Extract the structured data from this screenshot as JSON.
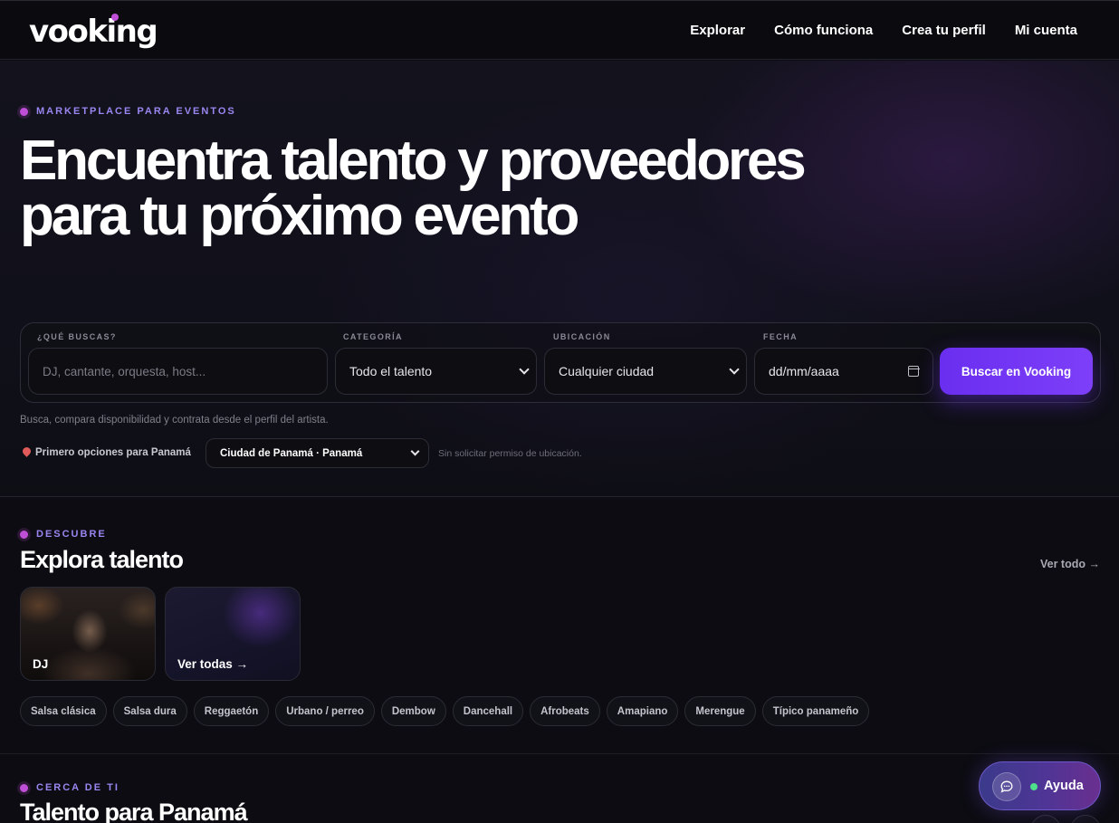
{
  "header": {
    "logo_text": "vooking",
    "nav": [
      "Explorar",
      "Cómo funciona",
      "Crea tu perfil",
      "Mi cuenta"
    ]
  },
  "hero": {
    "eyebrow": "MARKETPLACE PARA EVENTOS",
    "title": "Encuentra talento y proveedores para tu próximo evento",
    "search": {
      "what_label": "¿QUÉ BUSCAS?",
      "what_placeholder": "DJ, cantante, orquesta, host...",
      "category_label": "CATEGORÍA",
      "category_value": "Todo el talento",
      "location_label": "UBICACIÓN",
      "location_value": "Cualquier ciudad",
      "date_label": "FECHA",
      "date_placeholder": "dd/mm/aaaa",
      "button": "Buscar en Vooking"
    },
    "hint": "Busca, compara disponibilidad y contrata desde el perfil del artista.",
    "location_prompt": "Primero opciones para Panamá",
    "location_select": "Ciudad de Panamá · Panamá",
    "location_note": "Sin solicitar permiso de ubicación."
  },
  "discover": {
    "eyebrow": "DESCUBRE",
    "title": "Explora talento",
    "see_all": "Ver todo →",
    "cards": [
      "DJ",
      "Ver todas →"
    ],
    "chips": [
      "Salsa clásica",
      "Salsa dura",
      "Reggaetón",
      "Urbano / perreo",
      "Dembow",
      "Dancehall",
      "Afrobeats",
      "Amapiano",
      "Merengue",
      "Típico panameño"
    ]
  },
  "nearby": {
    "eyebrow": "CERCA DE TI",
    "title": "Talento para Panamá"
  },
  "help": {
    "label": "Ayuda"
  },
  "colors": {
    "accent": "#7d3ff8",
    "eyebrow": "#9a86f0",
    "dot": "#c04fd8",
    "background": "#0c0c12"
  }
}
